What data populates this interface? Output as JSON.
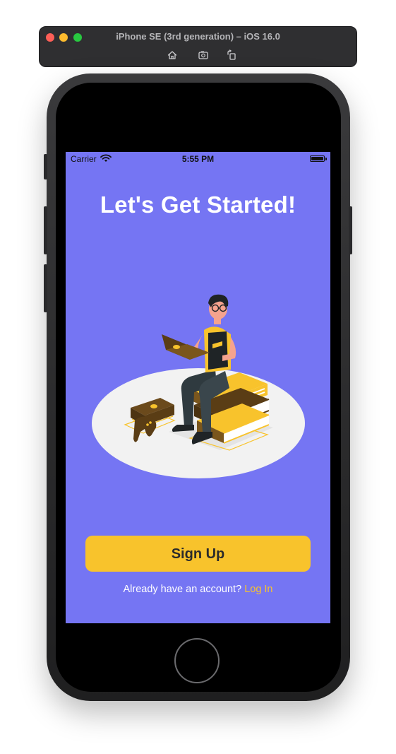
{
  "simulator": {
    "title": "iPhone SE (3rd generation) – iOS 16.0",
    "toolbar_icons": [
      "home-icon",
      "screenshot-icon",
      "rotate-icon"
    ]
  },
  "status_bar": {
    "carrier": "Carrier",
    "time": "5:55 PM"
  },
  "screen": {
    "background_color": "#7575f3",
    "headline": "Let's Get Started!",
    "illustration": "person-on-books-illustration",
    "signup_button": {
      "label": "Sign Up",
      "color": "#f8c32c"
    },
    "login_prompt": {
      "text": "Already have an account?",
      "link_label": "Log In",
      "link_color": "#f8c32c"
    }
  }
}
